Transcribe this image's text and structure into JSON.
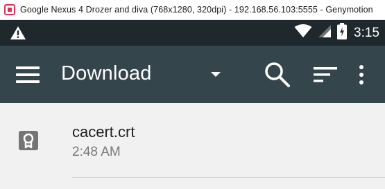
{
  "window": {
    "title": "Google Nexus 4 Drozer and diva (768x1280, 320dpi) - 192.168.56.103:5555 - Genymotion"
  },
  "status_bar": {
    "notification_icon": "warning-icon",
    "time": "3:15",
    "icons": [
      "wifi-icon",
      "cell-signal-icon",
      "battery-charging-icon"
    ]
  },
  "app_bar": {
    "title": "Download",
    "icons": [
      "menu-icon",
      "dropdown-arrow-icon",
      "search-icon",
      "sort-icon",
      "more-vert-icon"
    ]
  },
  "files": [
    {
      "name": "cacert.crt",
      "time": "2:48 AM",
      "icon": "certificate-icon"
    }
  ],
  "colors": {
    "status_bar": "#1f282c",
    "app_bar": "#35454c",
    "background": "#f1f1f1",
    "primary_text": "#212121",
    "secondary_text": "#7a7a7a"
  }
}
